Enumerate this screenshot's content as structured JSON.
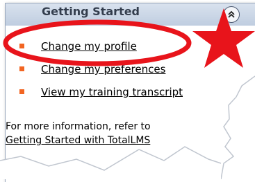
{
  "panel": {
    "title": "Getting Started"
  },
  "links": [
    "Change my profile",
    "Change my preferences",
    "View my training transcript"
  ],
  "info": {
    "line1": "For more information, refer to",
    "line2": "Getting Started with TotalLMS"
  },
  "colors": {
    "bullet": "#f26522",
    "highlight_ellipse": "#e8141b",
    "star": "#e8141b",
    "header": "#c9d5e6"
  },
  "icons": {
    "collapse": "double-chevron-up-icon",
    "star": "star-icon"
  }
}
